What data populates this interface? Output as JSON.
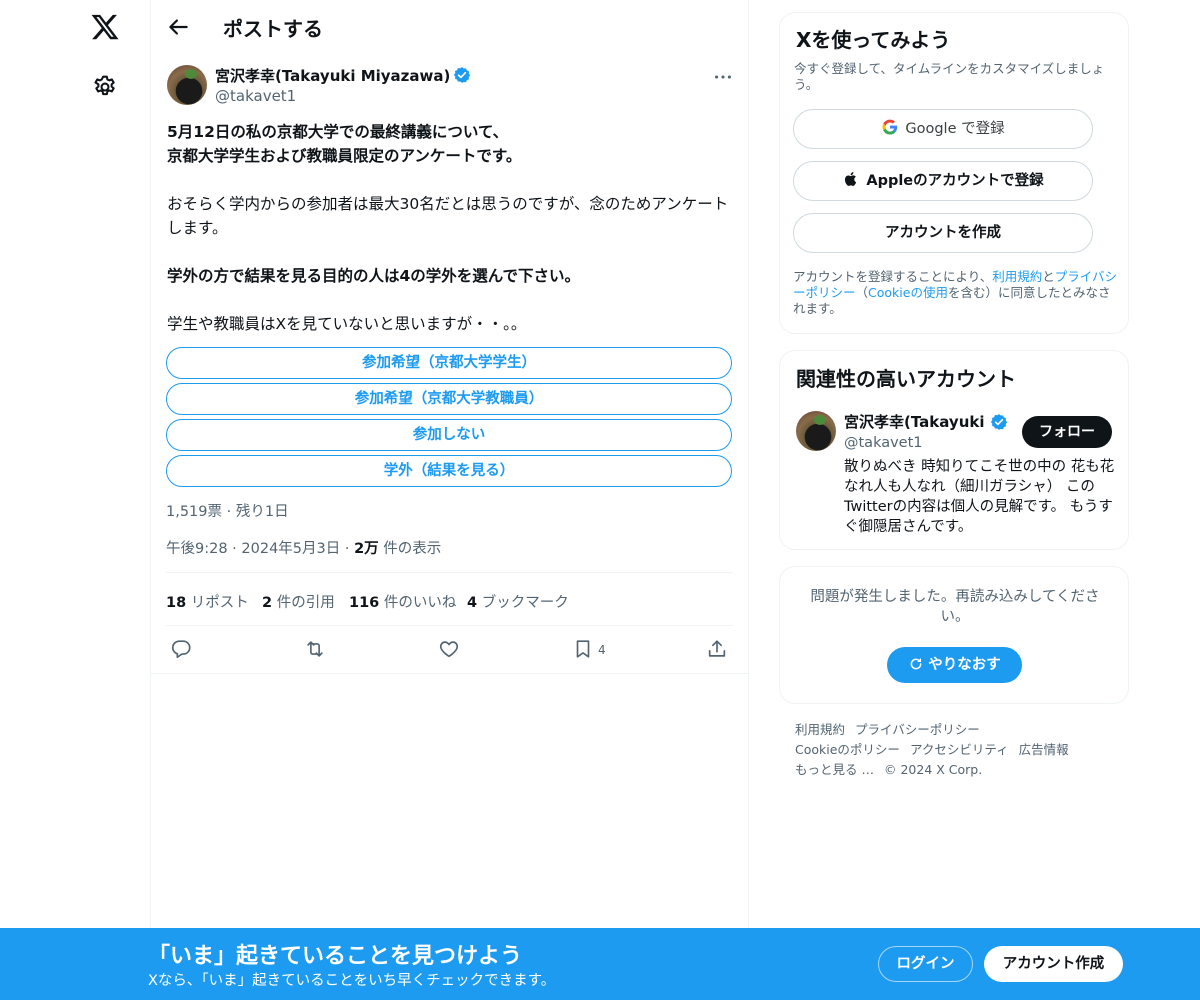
{
  "nav": {
    "logo_icon": "x-logo-icon",
    "settings_icon": "gear-icon"
  },
  "header": {
    "back_icon": "arrow-left-icon",
    "title": "ポストする"
  },
  "post": {
    "author_name": "宮沢孝幸(Takayuki Miyazawa)",
    "author_handle": "@takavet1",
    "text": {
      "line1": "5月12日の私の京都大学での最終講義について、",
      "line2": "京都大学学生および教職員限定のアンケートです。",
      "para2": "おそらく学内からの参加者は最大30名だとは思うのですが、念のためアンケートします。",
      "para3": "学外の方で結果を見る目的の人は4の学外を選んで下さい。",
      "para4": "学生や教職員はXを見ていないと思いますが・・。。"
    },
    "poll": {
      "options": [
        "参加希望（京都大学学生）",
        "参加希望（京都大学教職員）",
        "参加しない",
        "学外（結果を見る）"
      ],
      "meta": "1,519票 · 残り1日"
    },
    "timestamp": "午後9:28 · 2024年5月3日 · ",
    "views_num": "2万",
    "views_label": " 件の表示",
    "stats": {
      "reposts_n": "18",
      "reposts_label": " リポスト",
      "quotes_n": "2",
      "quotes_label": " 件の引用",
      "likes_n": "116",
      "likes_label": " 件のいいね",
      "bookmarks_n": "4",
      "bookmarks_label": " ブックマーク"
    },
    "bookmark_count": "4"
  },
  "signup_card": {
    "title": "Xを使ってみよう",
    "subtitle": "今すぐ登録して、タイムラインをカスタマイズしましょう。",
    "google_label": "Google で登録",
    "apple_label": "Appleのアカウントで登録",
    "create_label": "アカウントを作成",
    "terms_pre": "アカウントを登録することにより、",
    "terms_link1": "利用規約",
    "terms_and": "と",
    "terms_link2": "プライバシーポリシー",
    "terms_mid": "（",
    "terms_link3": "Cookieの使用",
    "terms_post": "を含む）に同意したとみなされます。"
  },
  "related": {
    "title": "関連性の高いアカウント",
    "name": "宮沢孝幸(Takayuki Miyazawa)",
    "handle": "@takavet1",
    "follow_label": "フォロー",
    "bio": "散りぬべき 時知りてこそ世の中の 花も花なれ人も人なれ（細川ガラシャ） このTwitterの内容は個人の見解です。 もうすぐ御隠居さんです。"
  },
  "error_card": {
    "text": "問題が発生しました。再読み込みしてください。",
    "retry_label": "やりなおす"
  },
  "footer": {
    "links": [
      "利用規約",
      "プライバシーポリシー",
      "Cookieのポリシー",
      "アクセシビリティ",
      "広告情報",
      "もっと見る …",
      "© 2024 X Corp."
    ]
  },
  "banner": {
    "title": "「いま」起きていることを見つけよう",
    "subtitle": "Xなら、「いま」起きていることをいち早くチェックできます。",
    "login_label": "ログイン",
    "signup_label": "アカウント作成"
  },
  "colors": {
    "accent": "#1d9bf0",
    "text": "#0f1419",
    "secondary": "#536471",
    "border": "#eff3f4"
  }
}
